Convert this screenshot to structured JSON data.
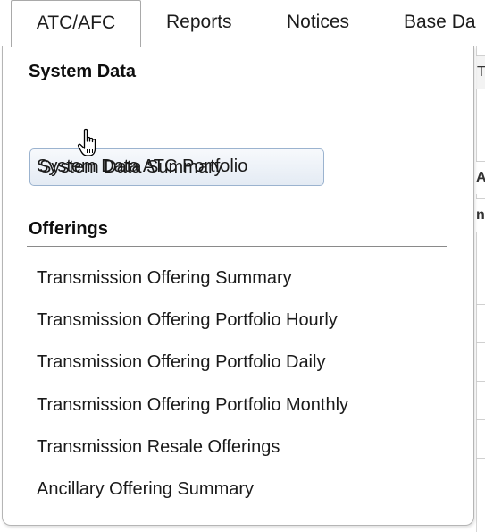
{
  "tabs": [
    {
      "label": "ATC/AFC",
      "active": true
    },
    {
      "label": "Reports",
      "active": false
    },
    {
      "label": "Notices",
      "active": false
    },
    {
      "label": "Base Da",
      "active": false
    }
  ],
  "menu": {
    "sections": [
      {
        "title": "System Data",
        "items": [
          "System Data Summary",
          "System Data ATC Portfolio"
        ]
      },
      {
        "title": "Offerings",
        "items": [
          "Transmission Offering Summary",
          "Transmission Offering Portfolio Hourly",
          "Transmission Offering Portfolio Daily",
          "Transmission Offering Portfolio Monthly",
          "Transmission Resale Offerings",
          "Ancillary Offering Summary"
        ]
      }
    ],
    "hovered_item": "System Data Summary"
  },
  "background_fragments": {
    "header_char": "T",
    "row_char_1": "A",
    "row_char_2": "n"
  },
  "colors": {
    "hover_border": "#9bb3cf",
    "hover_fill": "#e4ebf4",
    "menu_border": "#b5b5b5"
  },
  "icons": {
    "cursor": "hand-pointer-cursor-icon"
  }
}
